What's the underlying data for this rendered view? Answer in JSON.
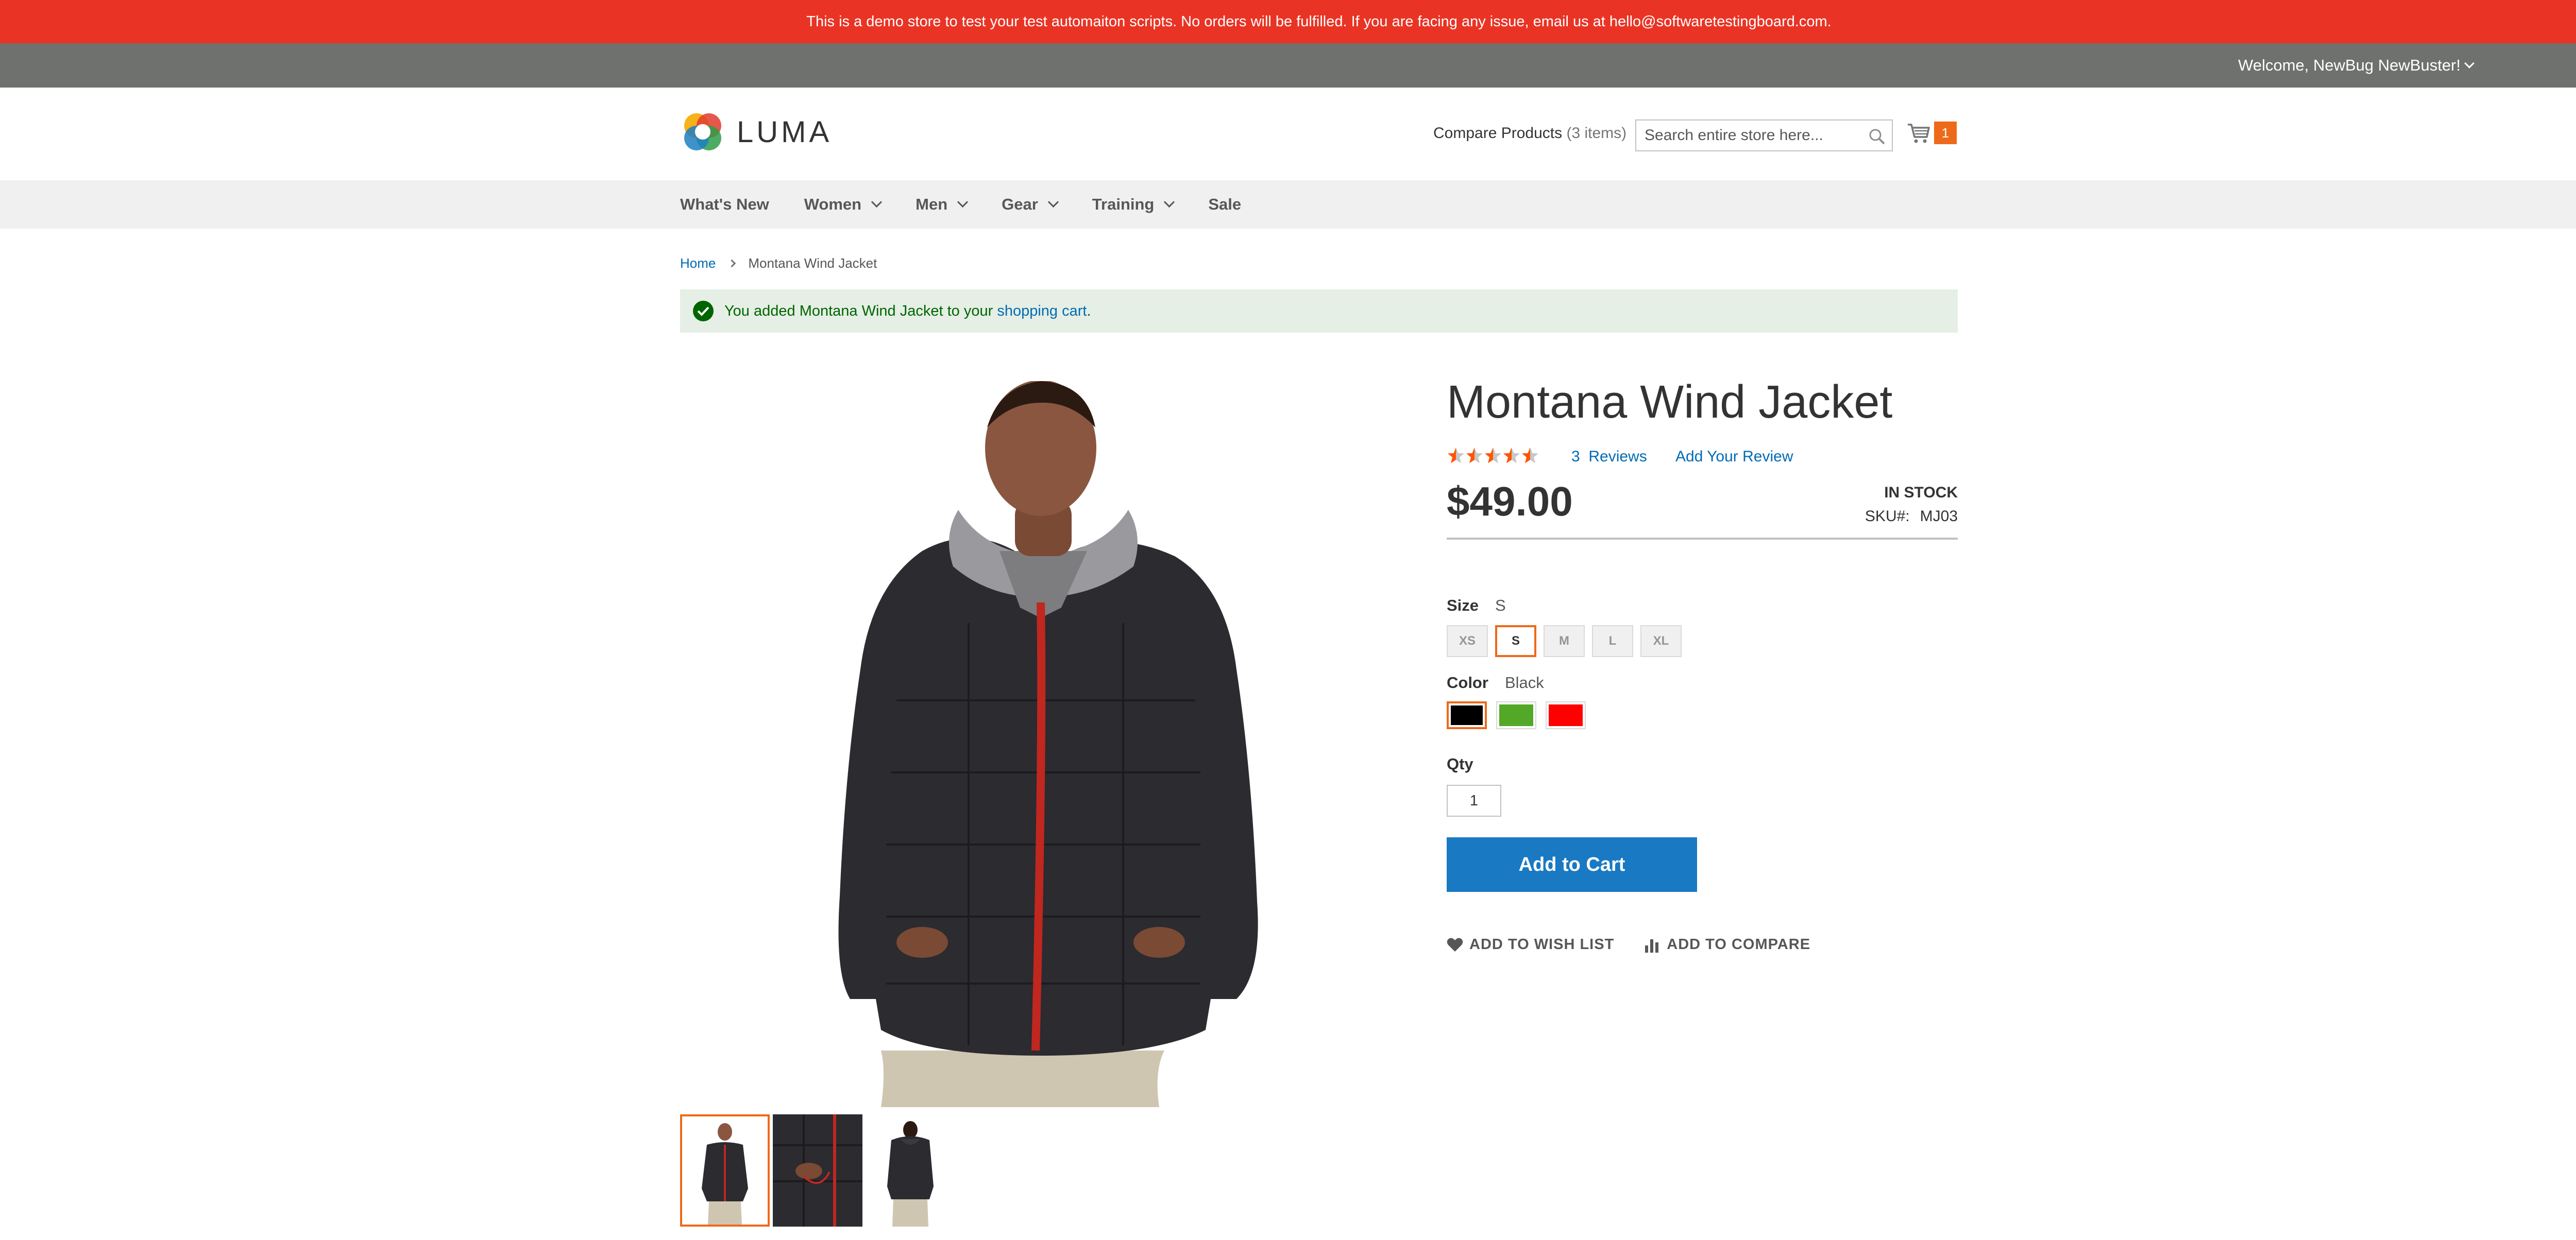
{
  "demo_banner": {
    "text": "This is a demo store to test your test automaiton scripts. No orders will be fulfilled. If you are facing any issue, email us at hello@softwaretestingboard.com."
  },
  "panel": {
    "welcome": "Welcome, NewBug NewBuster!"
  },
  "header": {
    "logo_text": "LUMA",
    "compare_label": "Compare Products",
    "compare_count": "(3 items)",
    "search_placeholder": "Search entire store here...",
    "cart_count": "1"
  },
  "nav": {
    "items": [
      {
        "label": "What's New",
        "dropdown": false
      },
      {
        "label": "Women",
        "dropdown": true
      },
      {
        "label": "Men",
        "dropdown": true
      },
      {
        "label": "Gear",
        "dropdown": true
      },
      {
        "label": "Training",
        "dropdown": true
      },
      {
        "label": "Sale",
        "dropdown": false
      }
    ]
  },
  "breadcrumb": {
    "home": "Home",
    "current": "Montana Wind Jacket"
  },
  "message": {
    "text_before": "You added Montana Wind Jacket to your ",
    "link": "shopping cart",
    "text_after": "."
  },
  "product": {
    "title": "Montana Wind Jacket",
    "rating_fraction": 0.5,
    "reviews_count": "3",
    "reviews_label": "Reviews",
    "add_review": "Add Your Review",
    "price": "$49.00",
    "stock": "IN STOCK",
    "sku_label": "SKU#:",
    "sku_value": "MJ03",
    "size_label": "Size",
    "size_selected": "S",
    "sizes": [
      "XS",
      "S",
      "M",
      "L",
      "XL"
    ],
    "color_label": "Color",
    "color_selected": "Black",
    "colors": [
      {
        "name": "Black",
        "hex": "#000000"
      },
      {
        "name": "Green",
        "hex": "#53a828"
      },
      {
        "name": "Red",
        "hex": "#ff0000"
      }
    ],
    "qty_label": "Qty",
    "qty_value": "1",
    "add_to_cart": "Add to Cart",
    "wishlist": "ADD TO WISH LIST",
    "compare": "ADD TO COMPARE"
  },
  "theme": {
    "accent": "#ee6a1a",
    "link": "#006bb4",
    "primary_button": "#1979c3",
    "banner": "#e93425"
  }
}
